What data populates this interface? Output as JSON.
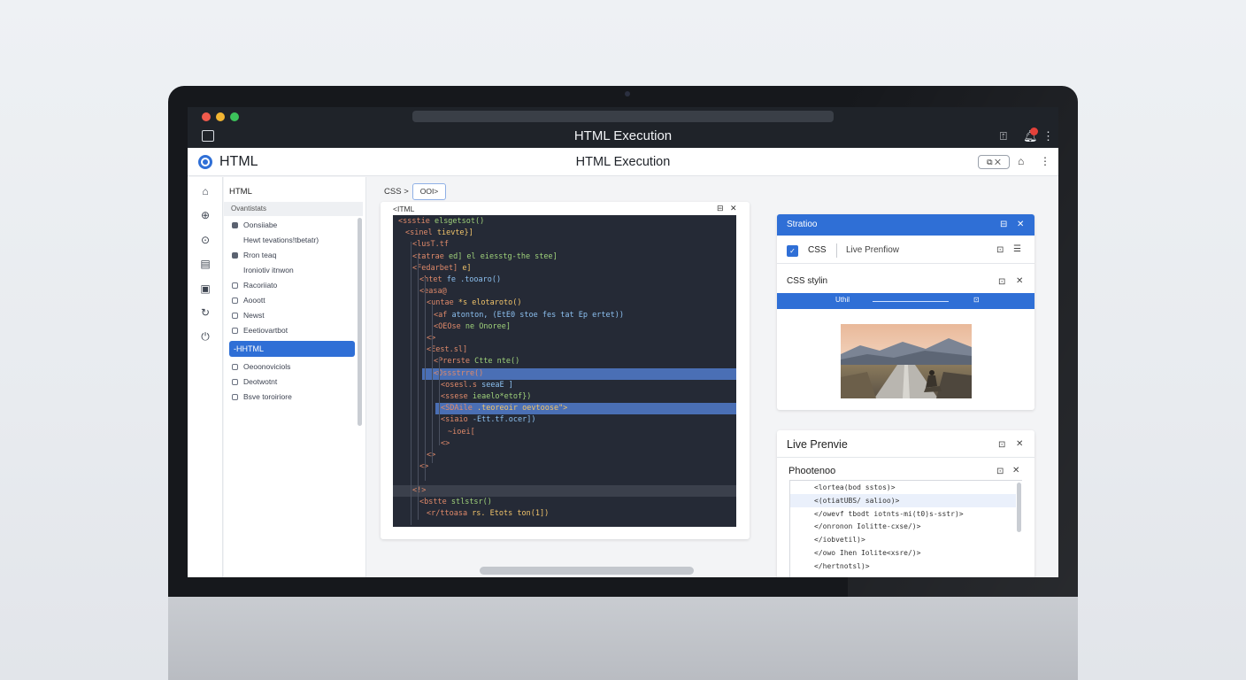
{
  "window": {
    "title": "HTML Execution"
  },
  "app": {
    "name": "HTML",
    "center_title": "HTML Execution",
    "pill_label": "⧉ ✕"
  },
  "explorer": {
    "title": "HTML",
    "subheader": "Ovantistats",
    "items": [
      {
        "label": "Oonsiiabe",
        "bullet": "filled"
      },
      {
        "label": "Hewt tevations!tbetatr)",
        "bullet": "none"
      },
      {
        "label": "Rron teaq",
        "bullet": "filled"
      },
      {
        "label": "Ironiotiv itnwon",
        "bullet": "none"
      },
      {
        "label": "Racoriiato",
        "bullet": "hollow"
      },
      {
        "label": "Aooott",
        "bullet": "hollow"
      },
      {
        "label": "Newst",
        "bullet": "hollow"
      },
      {
        "label": "Eeetiovartbot",
        "bullet": "hollow"
      }
    ],
    "selected": "-HHTML",
    "items_after": [
      {
        "label": "Oeoonoviciols",
        "bullet": "hollow"
      },
      {
        "label": "Deotwotnt",
        "bullet": "hollow"
      },
      {
        "label": "Bsve toroiriore",
        "bullet": "hollow"
      }
    ]
  },
  "breadcrumb": {
    "root": "CSS",
    "separator": ">",
    "tab": "OOI>"
  },
  "code_panel": {
    "title": "<ITML",
    "lines": [
      {
        "indent": 0,
        "tag": "<ssstie",
        "rest": "elsgetsot()",
        "style": "normal"
      },
      {
        "indent": 1,
        "tag": "<sinel",
        "rest": "tievte}]",
        "style": "normal"
      },
      {
        "indent": 2,
        "tag": "<lusT.tf",
        "rest": "",
        "style": "normal"
      },
      {
        "indent": 2,
        "tag": "<tatrae",
        "rest": "ed] el  eiesstg-the stee]",
        "style": "normal"
      },
      {
        "indent": 2,
        "tag": "<Fedarbet]",
        "rest": "e]",
        "style": "normal"
      },
      {
        "indent": 3,
        "tag": "<htet",
        "rest": "fe .tooaro()",
        "style": "normal"
      },
      {
        "indent": 3,
        "tag": "<easa@",
        "rest": "",
        "style": "normal"
      },
      {
        "indent": 4,
        "tag": "<untae",
        "rest": "*s elotaroto()",
        "style": "normal"
      },
      {
        "indent": 5,
        "tag": "<af",
        "rest": "atonton, (EtE0 stoe fes tat Ep ertet))",
        "style": "normal"
      },
      {
        "indent": 5,
        "tag": "<OEOse",
        "rest": "ne Onoree]",
        "style": "normal"
      },
      {
        "indent": 4,
        "tag": "<>",
        "rest": "",
        "style": "normal"
      },
      {
        "indent": 4,
        "tag": "<Eest.sl]",
        "rest": "",
        "style": "normal"
      },
      {
        "indent": 5,
        "tag": "<Prerste",
        "rest": "Ctte nte()",
        "style": "normal"
      },
      {
        "indent": 5,
        "tag": "<Ossstrre()",
        "rest": "",
        "style": "hl"
      },
      {
        "indent": 6,
        "tag": "<osesl.s",
        "rest": "seeaE ]",
        "style": "normal"
      },
      {
        "indent": 6,
        "tag": "<ssese",
        "rest": "ieaelo*etof})",
        "style": "normal"
      },
      {
        "indent": 6,
        "tag": "<SDAile",
        "rest": ".teoreoir oevtoose\">",
        "style": "hl2"
      },
      {
        "indent": 6,
        "tag": "<siaio",
        "rest": "-Ett.tf.ocer])",
        "style": "normal"
      },
      {
        "indent": 7,
        "tag": "~ioei[",
        "rest": "",
        "style": "normal"
      },
      {
        "indent": 6,
        "tag": "<>",
        "rest": "",
        "style": "normal"
      },
      {
        "indent": 4,
        "tag": "<>",
        "rest": "",
        "style": "normal"
      },
      {
        "indent": 3,
        "tag": "<>",
        "rest": "",
        "style": "normal"
      },
      {
        "indent": 2,
        "tag": "",
        "rest": "",
        "style": "blank"
      },
      {
        "indent": 2,
        "tag": "<!>",
        "rest": "",
        "style": "band"
      },
      {
        "indent": 3,
        "tag": "<bstte",
        "rest": "stlstsr()",
        "style": "normal"
      },
      {
        "indent": 4,
        "tag": "<r/ttoasa",
        "rest": "rs. Etots ton(1])",
        "style": "normal"
      }
    ]
  },
  "panel_css": {
    "header": "Stratioo",
    "tab_css": "CSS",
    "tab_live": "Live Prenfiow",
    "section": "CSS stylin",
    "strip_label": "Uthil",
    "strip_knob": "⊡"
  },
  "panel_live": {
    "title": "Live Prenvie",
    "subtitle": "Phootenoo",
    "rows": [
      {
        "text": "<lortea(bod sstos)>",
        "selected": false
      },
      {
        "text": "<(otiatUBS/ salioo)>",
        "selected": true
      },
      {
        "text": "</owevf tbodt iotnts-mi(t0)s-sstr)>",
        "selected": false
      },
      {
        "text": "</onronon Iolitte-cxse/)>",
        "selected": false
      },
      {
        "text": "</iobvetil)>",
        "selected": false
      },
      {
        "text": "</owo Ihen Iolite<xsre/)>",
        "selected": false
      },
      {
        "text": "</hertnotsl)>",
        "selected": false
      }
    ]
  },
  "colors": {
    "accent": "#2f6fd6",
    "code_bg": "#252a36",
    "titlebar": "#1f2329"
  }
}
